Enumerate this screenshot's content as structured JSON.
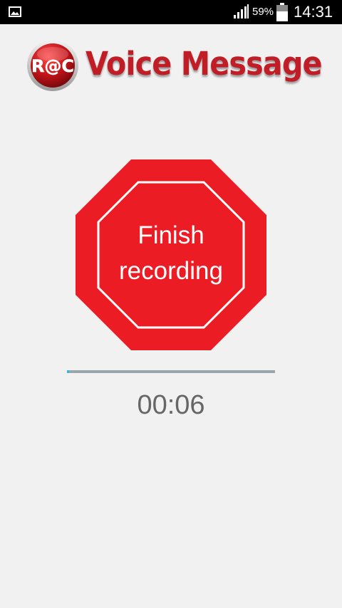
{
  "status_bar": {
    "battery_percent": "59%",
    "time": "14:31",
    "notification_icon": "gallery-icon",
    "signal_icon": "signal-icon",
    "battery_icon": "battery-icon",
    "battery_level": 0.59
  },
  "header": {
    "logo_text": "R@C",
    "title": "Voice Message",
    "title_color": "#c01d26"
  },
  "recorder": {
    "stop_button_label": "Finish\nrecording",
    "stop_button_color": "#ec1c24",
    "progress_fraction": 0.01,
    "elapsed": "00:06"
  }
}
